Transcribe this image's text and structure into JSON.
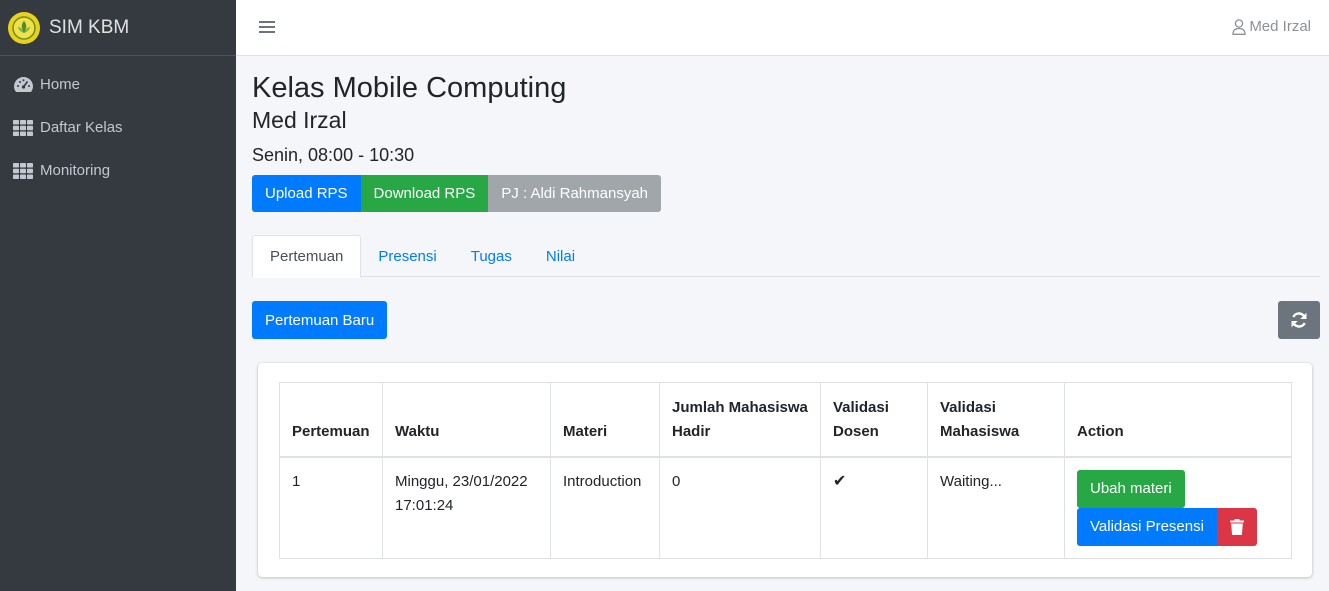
{
  "brand": {
    "name": "SIM KBM"
  },
  "sidebar": {
    "items": [
      {
        "label": "Home",
        "icon": "dashboard-icon"
      },
      {
        "label": "Daftar Kelas",
        "icon": "grid-icon"
      },
      {
        "label": "Monitoring",
        "icon": "grid-icon"
      }
    ]
  },
  "topbar": {
    "user": "Med Irzal"
  },
  "page": {
    "title": "Kelas Mobile Computing",
    "lecturer": "Med Irzal",
    "schedule": "Senin, 08:00 - 10:30"
  },
  "actions": {
    "upload": "Upload RPS",
    "download": "Download RPS",
    "pj": "PJ : Aldi Rahmansyah"
  },
  "tabs": [
    {
      "label": "Pertemuan",
      "active": true
    },
    {
      "label": "Presensi",
      "active": false
    },
    {
      "label": "Tugas",
      "active": false
    },
    {
      "label": "Nilai",
      "active": false
    }
  ],
  "new_meeting_label": "Pertemuan Baru",
  "table": {
    "headers": [
      "Pertemuan",
      "Waktu",
      "Materi",
      "Jumlah Mahasiswa Hadir",
      "Validasi Dosen",
      "Validasi Mahasiswa",
      "Action"
    ],
    "rows": [
      {
        "pertemuan": "1",
        "waktu": "Minggu, 23/01/2022 17:01:24",
        "materi": "Introduction",
        "hadir": "0",
        "validasi_dosen": "✔",
        "validasi_mahasiswa": "Waiting...",
        "btn_ubah": "Ubah materi",
        "btn_validasi": "Validasi Presensi"
      }
    ]
  },
  "colors": {
    "primary": "#007bff",
    "success": "#28a745",
    "danger": "#dc3545",
    "sidebar": "#343a40"
  }
}
